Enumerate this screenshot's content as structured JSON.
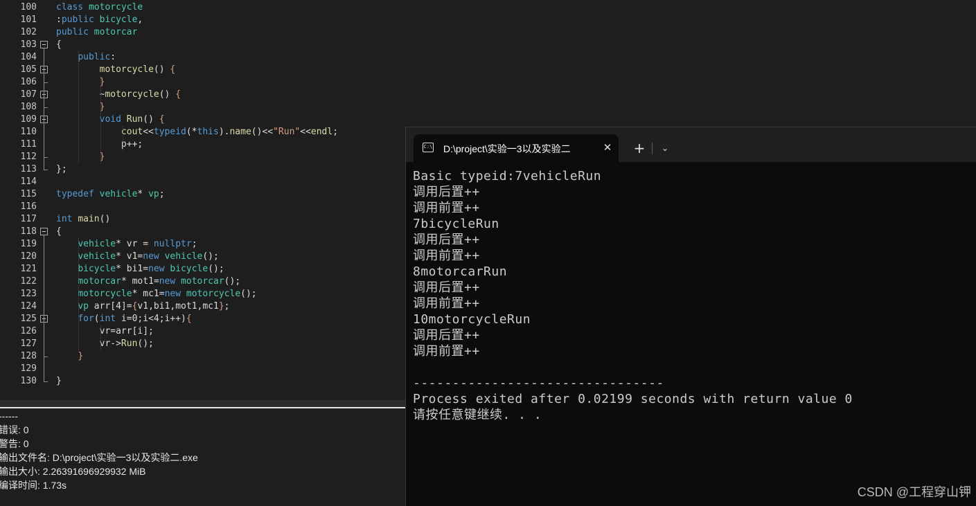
{
  "editor": {
    "lines": [
      {
        "n": "100",
        "html": "<span class=\"kw\">class</span> <span class=\"ty\">motorcycle</span>"
      },
      {
        "n": "101",
        "html": ":<span class=\"kw\">public</span> <span class=\"ty\">bicycle</span>,"
      },
      {
        "n": "102",
        "html": "<span class=\"kw\">public</span> <span class=\"ty\">motorcar</span>"
      },
      {
        "n": "103",
        "html": "{"
      },
      {
        "n": "104",
        "html": "    <span class=\"kw\">public</span>:"
      },
      {
        "n": "105",
        "html": "        <span class=\"fn\">motorcycle</span>() <span class=\"st\">{</span>"
      },
      {
        "n": "106",
        "html": "        <span class=\"st\">}</span>"
      },
      {
        "n": "107",
        "html": "        ~<span class=\"fn\">motorcycle</span>() <span class=\"st\">{</span>"
      },
      {
        "n": "108",
        "html": "        <span class=\"st\">}</span>"
      },
      {
        "n": "109",
        "html": "        <span class=\"kw\">void</span> <span class=\"fn\">Run</span>() <span class=\"st\">{</span>"
      },
      {
        "n": "110",
        "html": "            <span class=\"fn\">cout</span>&lt;&lt;<span class=\"kw\">typeid</span>(*<span class=\"kw\">this</span>).<span class=\"fn\">name</span>()&lt;&lt;<span class=\"st\">\"Run\"</span>&lt;&lt;<span class=\"fn\">endl</span>;"
      },
      {
        "n": "111",
        "html": "            p++;"
      },
      {
        "n": "112",
        "html": "        <span class=\"st\">}</span>"
      },
      {
        "n": "113",
        "html": "};"
      },
      {
        "n": "114",
        "html": ""
      },
      {
        "n": "115",
        "html": "<span class=\"kw\">typedef</span> <span class=\"ty\">vehicle</span>* <span class=\"ty\">vp</span>;"
      },
      {
        "n": "116",
        "html": ""
      },
      {
        "n": "117",
        "html": "<span class=\"kw\">int</span> <span class=\"fn\">main</span>()"
      },
      {
        "n": "118",
        "html": "{"
      },
      {
        "n": "119",
        "html": "    <span class=\"ty\">vehicle</span>* vr = <span class=\"kw\">nullptr</span>;"
      },
      {
        "n": "120",
        "html": "    <span class=\"ty\">vehicle</span>* v1=<span class=\"kw\">new</span> <span class=\"ty\">vehicle</span>();"
      },
      {
        "n": "121",
        "html": "    <span class=\"ty\">bicycle</span>* bi1=<span class=\"kw\">new</span> <span class=\"ty\">bicycle</span>();"
      },
      {
        "n": "122",
        "html": "    <span class=\"ty\">motorcar</span>* mot1=<span class=\"kw\">new</span> <span class=\"ty\">motorcar</span>();"
      },
      {
        "n": "123",
        "html": "    <span class=\"ty\">motorcycle</span>* mc1=<span class=\"kw\">new</span> <span class=\"ty\">motorcycle</span>();"
      },
      {
        "n": "124",
        "html": "    <span class=\"ty\">vp</span> arr[4]=<span class=\"st\">{</span>v1,bi1,mot1,mc1<span class=\"st\">}</span>;"
      },
      {
        "n": "125",
        "html": "    <span class=\"kw\">for</span>(<span class=\"kw\">int</span> i=0;i&lt;4;i++)<span class=\"st\">{</span>"
      },
      {
        "n": "126",
        "html": "        vr=arr[i];"
      },
      {
        "n": "127",
        "html": "        vr-&gt;<span class=\"fn\">Run</span>();"
      },
      {
        "n": "128",
        "html": "    <span class=\"st\">}</span>"
      },
      {
        "n": "129",
        "html": ""
      },
      {
        "n": "130",
        "html": "}"
      }
    ]
  },
  "log": {
    "lines": [
      "------",
      "错误: 0",
      "警告: 0",
      "输出文件名: D:\\project\\实验一3以及实验二.exe",
      "输出大小: 2.26391696929932 MiB",
      "编译时间: 1.73s"
    ]
  },
  "terminal": {
    "tab_icon": "C:\\",
    "tab_title": "D:\\project\\实验一3以及实验二",
    "close_glyph": "✕",
    "new_tab_glyph": "+",
    "dropdown_glyph": "⌄",
    "lines": [
      "Basic typeid:7vehicleRun",
      "调用后置++",
      "调用前置++",
      "7bicycleRun",
      "调用后置++",
      "调用前置++",
      "8motorcarRun",
      "调用后置++",
      "调用前置++",
      "10motorcycleRun",
      "调用后置++",
      "调用前置++",
      "",
      "--------------------------------",
      "Process exited after 0.02199 seconds with return value 0",
      "请按任意键继续. . ."
    ]
  },
  "watermark": "CSDN @工程穿山钾",
  "colors": {
    "editor_bg": "#1e1e1e",
    "keyword": "#569cd6",
    "type": "#4ec9b0",
    "function": "#dcdcaa",
    "string": "#d69d85",
    "terminal_bg": "#0c0c0c"
  }
}
